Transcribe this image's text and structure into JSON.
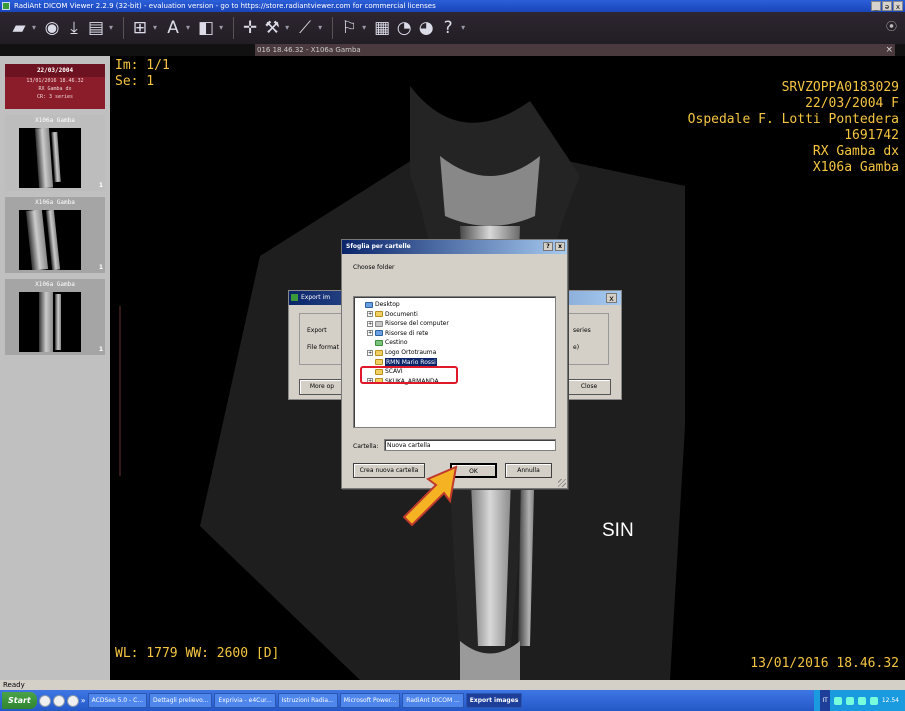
{
  "window": {
    "title": "RadiAnt DICOM Viewer 2.2.9 (32-bit) - evaluation version - go to https://store.radiantviewer.com for commercial licenses",
    "controls": [
      "_",
      "ə",
      "x"
    ]
  },
  "toolbar": {
    "buttons": [
      {
        "name": "open-folder-icon",
        "glyph": "▰",
        "arrow": true
      },
      {
        "name": "cd-icon",
        "glyph": "◉",
        "arrow": false
      },
      {
        "name": "download-icon",
        "glyph": "⤓",
        "arrow": false
      },
      {
        "name": "save-icon",
        "glyph": "▤",
        "arrow": true
      },
      {
        "name": "layout-icon",
        "glyph": "⊞",
        "arrow": true
      },
      {
        "name": "annotation-text-icon",
        "glyph": "A",
        "arrow": true
      },
      {
        "name": "window-level-icon",
        "glyph": "◧",
        "arrow": true
      },
      {
        "name": "pan-icon",
        "glyph": "✛",
        "arrow": false
      },
      {
        "name": "zoom-icon",
        "glyph": "⚒",
        "arrow": true
      },
      {
        "name": "measure-icon",
        "glyph": "⟋",
        "arrow": true
      },
      {
        "name": "reset-icon",
        "glyph": "⚐",
        "arrow": true
      },
      {
        "name": "film-icon",
        "glyph": "▦",
        "arrow": false
      },
      {
        "name": "cine-icon",
        "glyph": "◔",
        "arrow": false
      },
      {
        "name": "mpr-icon",
        "glyph": "◕",
        "arrow": false
      },
      {
        "name": "help-icon",
        "glyph": "?",
        "arrow": true
      }
    ],
    "corner": "⦿"
  },
  "tab": {
    "label": "016 18.46.32 - X106a Gamba",
    "close": "×"
  },
  "sidebar": {
    "study": {
      "date": "22/03/2004",
      "datetime": "13/01/2016 18.46.32",
      "description": "RX Gamba dx",
      "info": "CR: 3 series"
    },
    "series": [
      {
        "label": "X106a Gamba",
        "count": "1"
      },
      {
        "label": "X106a Gamba",
        "count": "1"
      },
      {
        "label": "X106a Gamba",
        "count": "1"
      }
    ]
  },
  "viewer": {
    "top_left": [
      "Im: 1/1",
      "Se: 1"
    ],
    "top_right": [
      "SRVZOPPA0183029",
      "22/03/2004 F",
      "Ospedale F. Lotti Pontedera",
      "1691742",
      "RX Gamba dx",
      "X106a Gamba"
    ],
    "bottom_left": "WL: 1779 WW: 2600 [D]",
    "bottom_right": "13/01/2016 18.46.32",
    "side_marker": "SIN"
  },
  "export_dialog": {
    "title": "Export im",
    "close": "x",
    "export_label": "Export",
    "file_format_label": "File format",
    "series_text": "series",
    "paren_text": "e)",
    "more_options": "More op",
    "close_button": "Close"
  },
  "browse_dialog": {
    "title": "Sfoglia per cartelle",
    "help": "?",
    "close": "x",
    "instruction": "Choose folder",
    "tree": [
      {
        "label": "Desktop",
        "expander": "",
        "icon": "blue",
        "indent": 0,
        "selected": false
      },
      {
        "label": "Documenti",
        "expander": "+",
        "icon": "yellow",
        "indent": 1,
        "selected": false
      },
      {
        "label": "Risorse del computer",
        "expander": "+",
        "icon": "gray",
        "indent": 1,
        "selected": false
      },
      {
        "label": "Risorse di rete",
        "expander": "+",
        "icon": "blue",
        "indent": 1,
        "selected": false
      },
      {
        "label": "Cestino",
        "expander": "",
        "icon": "green",
        "indent": 1,
        "selected": false
      },
      {
        "label": "Logo Ortotrauma",
        "expander": "+",
        "icon": "yellow",
        "indent": 1,
        "selected": false
      },
      {
        "label": "RMN Mario Rossi",
        "expander": "",
        "icon": "yellow",
        "indent": 1,
        "selected": true
      },
      {
        "label": "SCAVI",
        "expander": "",
        "icon": "yellow",
        "indent": 1,
        "selected": false
      },
      {
        "label": "SKUKA_ARMANDA",
        "expander": "+",
        "icon": "yellow",
        "indent": 1,
        "selected": false
      }
    ],
    "folder_label": "Cartella:",
    "folder_value": "Nuova cartella",
    "new_folder_button": "Crea nuova cartella",
    "ok_button": "OK",
    "cancel_button": "Annulla"
  },
  "status_bar": {
    "text": "Ready"
  },
  "taskbar": {
    "start": "Start",
    "more": "»",
    "tasks": [
      {
        "label": "ACDSee 5.0 - C...",
        "active": false
      },
      {
        "label": "Dettagli prelievo...",
        "active": false
      },
      {
        "label": "Exprivia - e4Cur...",
        "active": false
      },
      {
        "label": "Istruzioni Radia...",
        "active": false
      },
      {
        "label": "Microsoft Power...",
        "active": false
      },
      {
        "label": "RadiAnt DICOM ...",
        "active": false
      },
      {
        "label": "Export images",
        "active": true
      }
    ],
    "lang": "IT",
    "clock": "12.54"
  },
  "colors": {
    "overlay_text": "#f5c542",
    "viewer_bg": "#000000",
    "study_header": "#8b1c2a",
    "highlight": "#e0192a",
    "arrow_fill": "#f5b324"
  }
}
